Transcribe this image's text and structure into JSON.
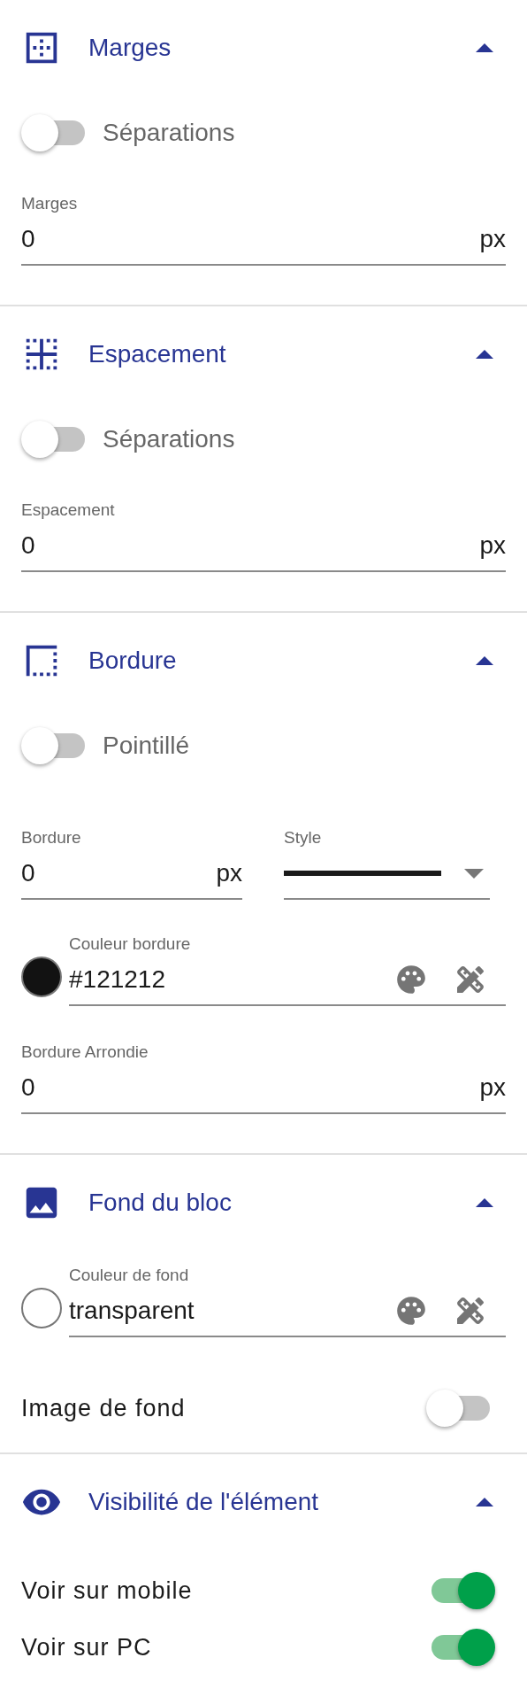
{
  "sections": [
    {
      "title": "Marges",
      "expanded": true,
      "items": [
        {
          "kind": "toggle_left",
          "label": "Séparations",
          "on": false
        },
        {
          "kind": "field",
          "label": "Marges",
          "value": "0",
          "unit": "px"
        }
      ]
    },
    {
      "title": "Espacement",
      "expanded": true,
      "items": [
        {
          "kind": "toggle_left",
          "label": "Séparations",
          "on": false
        },
        {
          "kind": "field",
          "label": "Espacement",
          "value": "0",
          "unit": "px"
        }
      ]
    },
    {
      "title": "Bordure",
      "expanded": true,
      "items": [
        {
          "kind": "toggle_left",
          "label": "Pointillé",
          "on": false
        },
        {
          "kind": "pair",
          "left": {
            "label": "Bordure",
            "value": "0",
            "unit": "px"
          },
          "right": {
            "label": "Style"
          }
        },
        {
          "kind": "color",
          "label": "Couleur bordure",
          "value": "#121212",
          "color": "#121212"
        },
        {
          "kind": "field",
          "label": "Bordure Arrondie",
          "value": "0",
          "unit": "px"
        }
      ]
    },
    {
      "title": "Fond du bloc",
      "expanded": true,
      "items": [
        {
          "kind": "color",
          "label": "Couleur de fond",
          "value": "transparent"
        },
        {
          "kind": "toggle_right",
          "label": "Image de fond",
          "on": false
        }
      ]
    },
    {
      "title": "Visibilité de l'élément",
      "expanded": true,
      "items": [
        {
          "kind": "toggle_right",
          "label": "Voir sur mobile",
          "on": true
        },
        {
          "kind": "toggle_right",
          "label": "Voir sur PC",
          "on": true
        }
      ]
    }
  ]
}
